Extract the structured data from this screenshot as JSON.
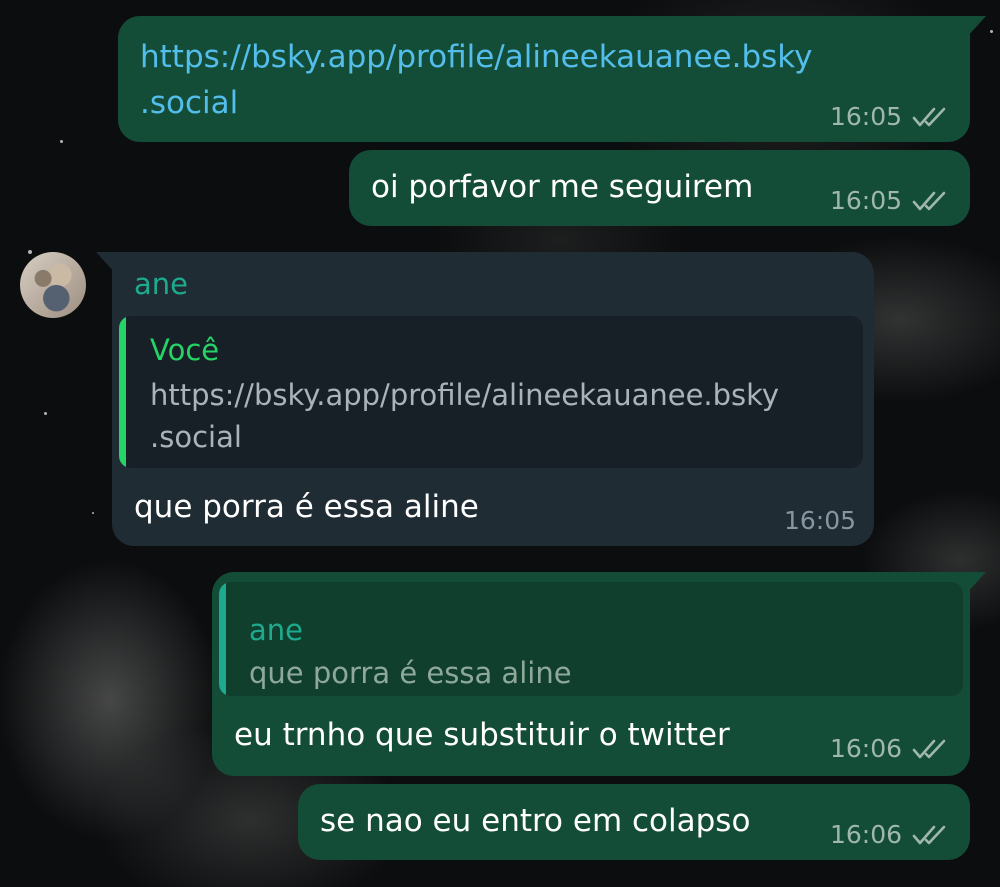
{
  "messages": [
    {
      "id": "m1",
      "direction": "outgoing",
      "text_line1": "https://bsky.app/profile/alineekauanee.bsky",
      "text_line2": ".social",
      "time": "16:05",
      "status": "read"
    },
    {
      "id": "m2",
      "direction": "outgoing",
      "text": "oi porfavor me seguirem",
      "time": "16:05",
      "status": "read"
    },
    {
      "id": "m3",
      "direction": "incoming",
      "sender": "ane",
      "quote": {
        "author": "Você",
        "text_line1": "https://bsky.app/profile/alineekauanee.bsky",
        "text_line2": ".social"
      },
      "text": "que porra é essa aline",
      "time": "16:05"
    },
    {
      "id": "m4",
      "direction": "outgoing",
      "quote": {
        "author": "ane",
        "text": "que porra é essa aline"
      },
      "text": "eu trnho que substituir o twitter",
      "time": "16:06",
      "status": "read"
    },
    {
      "id": "m5",
      "direction": "outgoing",
      "text": "se nao eu entro em colapso",
      "time": "16:06",
      "status": "read"
    }
  ],
  "icons": {
    "read_receipt": "double-check-icon",
    "avatar": "contact-avatar"
  },
  "colors": {
    "outgoing_bubble": "#144d37",
    "incoming_bubble": "#1f2c34",
    "link": "#53bdeb",
    "sender_name": "#1eaa8e",
    "quote_you": "#25d366"
  }
}
